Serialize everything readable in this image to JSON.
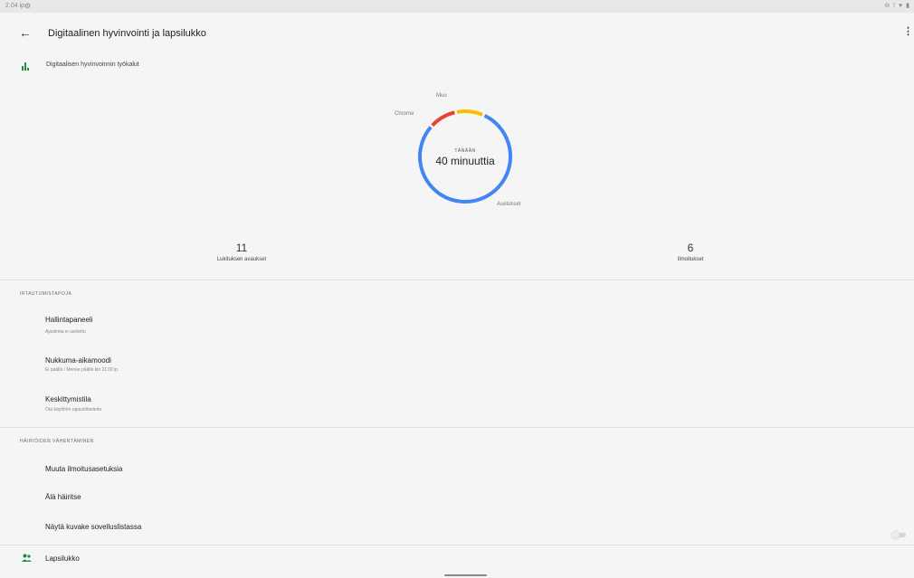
{
  "status_bar": {
    "time": "2.04 ip.",
    "settings_glyph": "⚙",
    "right_icons": "⊖ ! ♥ ▮"
  },
  "app_bar": {
    "back_glyph": "←",
    "title": "Digitaalinen hyvinvointi ja lapsilukko",
    "more_glyph": "⋮"
  },
  "tools": {
    "label": "Digitaalisen hyvinvoinnin työkalut",
    "icon": "bar-chart-icon"
  },
  "donut": {
    "center_caption": "TÄNÄÄN",
    "center_value": "40 minuuttia",
    "segments": [
      {
        "label": "Muu",
        "fraction": 0.1,
        "color": "#fbbc04"
      },
      {
        "label": "Asetukset",
        "fraction": 0.8,
        "color": "#4285f4"
      },
      {
        "label": "Chrome",
        "fraction": 0.1,
        "color": "#ea4335"
      }
    ]
  },
  "stats": [
    {
      "value": "11",
      "caption": "Lukituksen avaukset"
    },
    {
      "value": "6",
      "caption": "Ilmoitukset"
    }
  ],
  "sections": {
    "disconnect_title": "IRTAUTUMISTAPOJA",
    "disconnect_items": [
      {
        "title": "Hallintapaneeli",
        "subtitle": "Ajastimia ei asetettu"
      },
      {
        "title": "Nukkuma-aikamoodi",
        "subtitle": "Ei päällä / Menee päälle klo 11.00 ip."
      },
      {
        "title": "Keskittymistila",
        "subtitle": "Ota käyttöön rajaustilanteita"
      }
    ],
    "reduce_title": "HÄIRIÖIDEN VÄHENTÄMINEN",
    "reduce_items": [
      {
        "title": "Muuta ilmoitusasetuksia"
      },
      {
        "title": "Älä häiritse"
      },
      {
        "title": "Näytä kuvake sovelluslistassa",
        "toggle_on": false
      }
    ]
  },
  "parental": {
    "label": "Lapsilukko",
    "icon": "people-icon"
  }
}
